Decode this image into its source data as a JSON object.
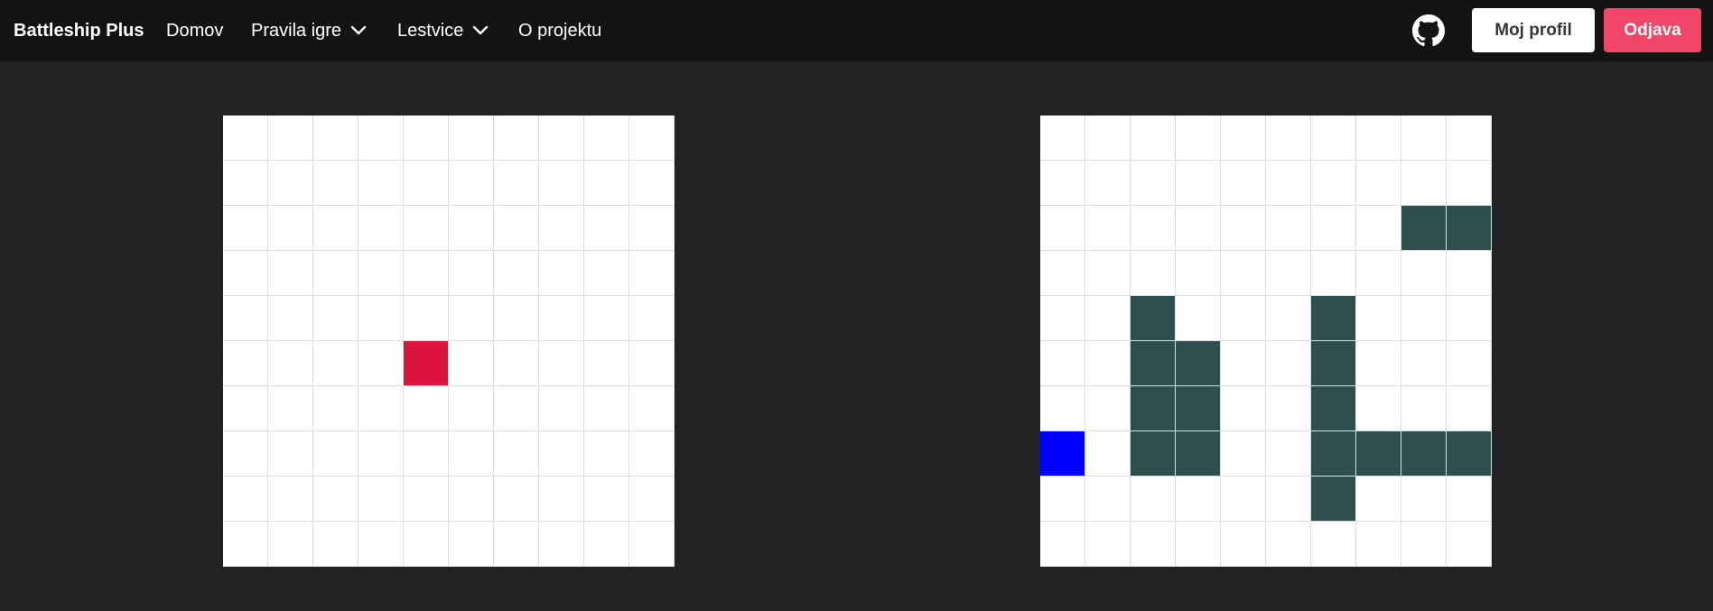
{
  "navbar": {
    "brand": "Battleship Plus",
    "items": [
      {
        "label": "Domov",
        "dropdown": false
      },
      {
        "label": "Pravila igre",
        "dropdown": true
      },
      {
        "label": "Lestvice",
        "dropdown": true
      },
      {
        "label": "O projektu",
        "dropdown": false
      }
    ],
    "github_icon": "github-icon",
    "profile_button": "Moj profil",
    "logout_button": "Odjava"
  },
  "colors": {
    "background": "#232323",
    "navbar": "#141414",
    "hit": "#dc143c",
    "ship": "#2f4f4f",
    "selection": "#0000ff",
    "logout": "#f14668"
  },
  "boards": {
    "size": 10,
    "opponent": {
      "hits": [
        [
          5,
          4
        ]
      ]
    },
    "player": {
      "ships": [
        [
          2,
          8
        ],
        [
          2,
          9
        ],
        [
          4,
          2
        ],
        [
          5,
          2
        ],
        [
          6,
          2
        ],
        [
          7,
          2
        ],
        [
          5,
          3
        ],
        [
          6,
          3
        ],
        [
          7,
          3
        ],
        [
          4,
          6
        ],
        [
          5,
          6
        ],
        [
          6,
          6
        ],
        [
          7,
          6
        ],
        [
          8,
          6
        ],
        [
          7,
          7
        ],
        [
          7,
          8
        ],
        [
          7,
          9
        ]
      ],
      "selected": [
        [
          7,
          0
        ]
      ]
    }
  }
}
